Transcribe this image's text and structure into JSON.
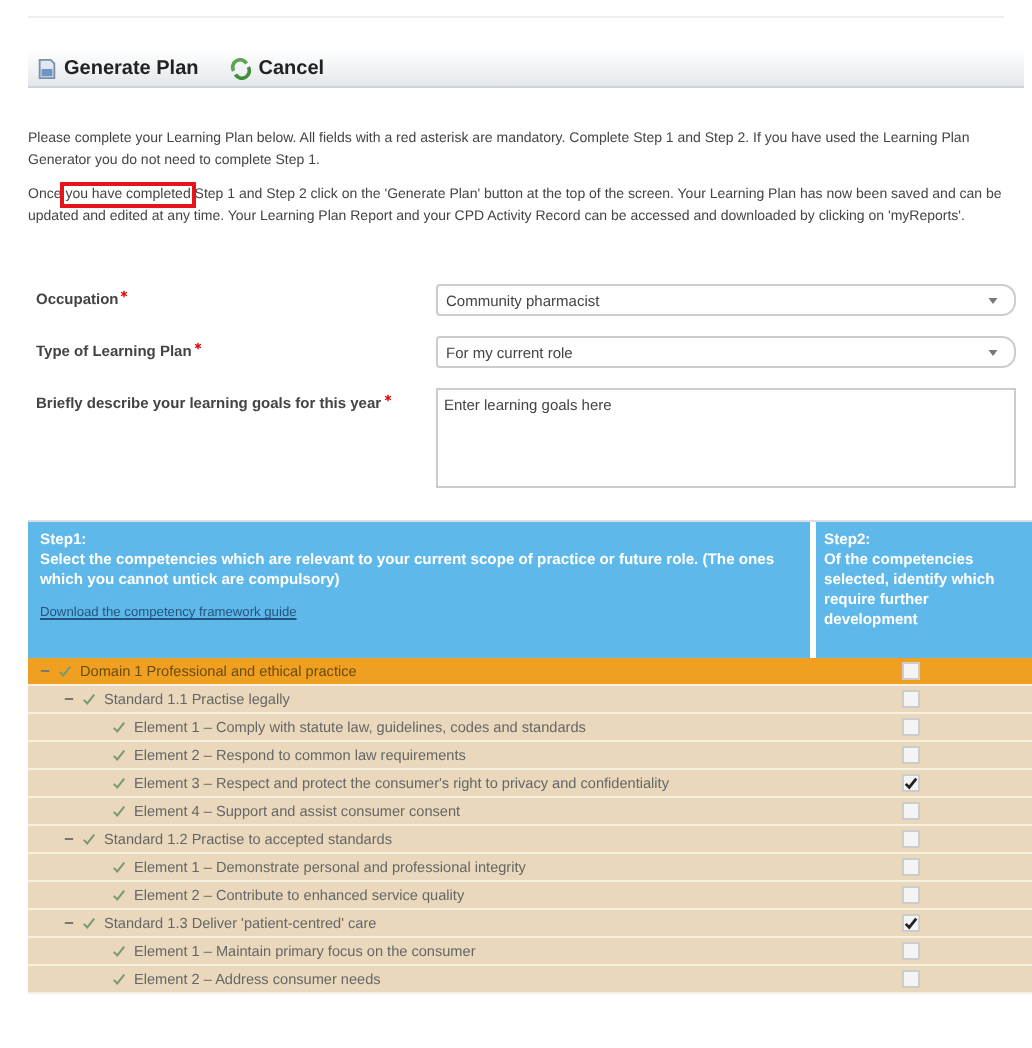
{
  "toolbar": {
    "buttons": [
      {
        "kind": "generate",
        "label": "Generate Plan"
      },
      {
        "kind": "cancel",
        "label": "Cancel"
      }
    ]
  },
  "intro": [
    {
      "parts": [
        {
          "text": "Please complete your Learning Plan below. All fields with a red asterisk are mandatory. Complete Step 1 and Step 2. If you have used the Learning Plan Generator you do not need to complete Step 1.",
          "highlighted": false
        }
      ]
    },
    {
      "parts": [
        {
          "text": "Once ",
          "highlighted": false
        },
        {
          "text": "you have completed",
          "highlighted": true
        },
        {
          "text": " Step 1 and Step 2 click on the 'Generate Plan' button at the top of the screen. Your Learning Plan has now been saved and can be updated and edited at any time. Your Learning Plan Report and your CPD Activity Record can be accessed and downloaded by clicking on 'myReports'.",
          "highlighted": false
        }
      ]
    }
  ],
  "form": [
    {
      "kind": "select",
      "label": "Occupation",
      "required": true,
      "value": "Community pharmacist"
    },
    {
      "kind": "select",
      "label": "Type of Learning Plan",
      "required": true,
      "value": "For my current role"
    },
    {
      "kind": "textarea",
      "label": "Briefly describe your learning goals for this year",
      "required": true,
      "placeholder": "Enter learning goals here"
    }
  ],
  "step1": {
    "title": "Step1:",
    "text": "Select the competencies which are relevant to your current scope of practice or future role.  (The ones which you cannot untick are compulsory)",
    "link": "Download the competency framework guide"
  },
  "step2": {
    "title": "Step2:",
    "text": "Of the competencies selected, identify which require further development"
  },
  "tree": [
    {
      "label": "Domain 1 Professional and ethical practice",
      "expanded": true,
      "ticked": true,
      "further_development": false,
      "children": [
        {
          "label": "Standard 1.1 Practise legally",
          "expanded": true,
          "ticked": true,
          "further_development": false,
          "children": [
            {
              "label": "Element 1 – Comply with statute law, guidelines, codes and standards",
              "ticked": true,
              "further_development": false
            },
            {
              "label": "Element 2 – Respond to common law requirements",
              "ticked": true,
              "further_development": false
            },
            {
              "label": "Element 3 – Respect and protect the consumer's right to privacy and confidentiality",
              "ticked": true,
              "further_development": true
            },
            {
              "label": "Element 4 – Support and assist consumer consent",
              "ticked": true,
              "further_development": false
            }
          ]
        },
        {
          "label": "Standard 1.2 Practise to accepted standards",
          "expanded": true,
          "ticked": true,
          "further_development": false,
          "children": [
            {
              "label": "Element 1 – Demonstrate personal and professional integrity",
              "ticked": true,
              "further_development": false
            },
            {
              "label": "Element 2 – Contribute to enhanced service quality",
              "ticked": true,
              "further_development": false
            }
          ]
        },
        {
          "label": "Standard 1.3 Deliver 'patient-centred' care",
          "expanded": true,
          "ticked": true,
          "further_development": true,
          "children": [
            {
              "label": "Element 1 – Maintain primary focus on the consumer",
              "ticked": true,
              "further_development": false
            },
            {
              "label": "Element 2 – Address consumer needs",
              "ticked": true,
              "further_development": false
            }
          ]
        }
      ]
    }
  ]
}
